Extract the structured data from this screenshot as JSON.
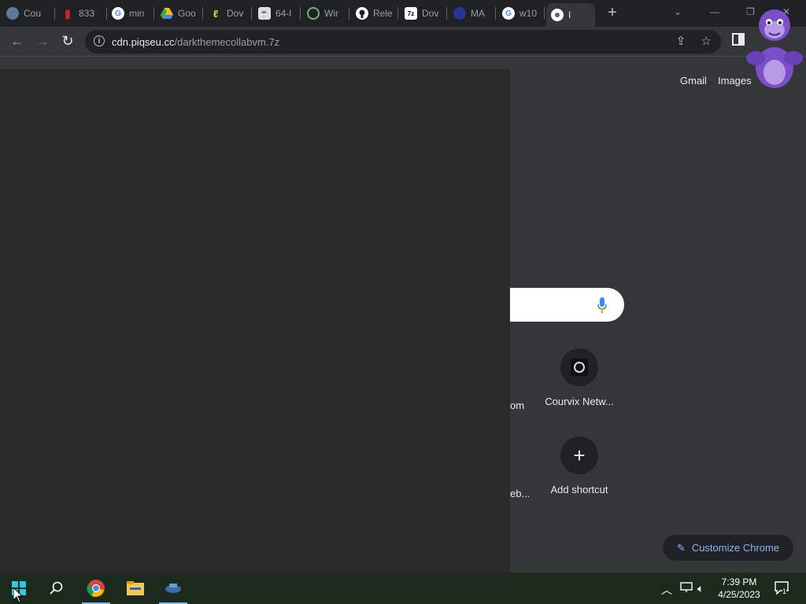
{
  "browser": {
    "tabs": [
      {
        "label": "Cou",
        "icon": "globe-icon",
        "color": "#8ab4f8"
      },
      {
        "label": "833",
        "icon": "red-mark-icon",
        "color": "#c62828"
      },
      {
        "label": "min",
        "icon": "google-icon",
        "color": "#ffffff"
      },
      {
        "label": "Goo",
        "icon": "drive-icon",
        "color": "#fbbc04"
      },
      {
        "label": "Dov",
        "icon": "leaf-icon",
        "color": "#cddc39"
      },
      {
        "label": "64-l",
        "icon": "java-icon",
        "color": "#ffffff"
      },
      {
        "label": "Wir",
        "icon": "chat-icon",
        "color": "#66bb6a"
      },
      {
        "label": "Rele",
        "icon": "github-icon",
        "color": "#ffffff"
      },
      {
        "label": "Dov",
        "icon": "7zip-icon",
        "color": "#ffffff"
      },
      {
        "label": "MA",
        "icon": "mas-icon",
        "color": "#3949ab"
      },
      {
        "label": "w10",
        "icon": "google-icon",
        "color": "#ffffff"
      },
      {
        "label": "I",
        "icon": "chrome-icon",
        "color": "#ffffff",
        "active": true
      }
    ],
    "new_tab_label": "+",
    "url_host": "cdn.piqseu.cc",
    "url_path": "/darkthemecollabvm.7z"
  },
  "ntp": {
    "gmail_label": "Gmail",
    "images_label": "Images",
    "shortcuts": [
      {
        "label": "Courvix Netw...",
        "icon": "courvix-icon"
      },
      {
        "label": "Add shortcut",
        "icon": "plus-icon"
      }
    ],
    "partial_labels": [
      "om",
      "eb..."
    ],
    "customize_label": "Customize Chrome"
  },
  "taskbar": {
    "time": "7:39 PM",
    "date": "4/25/2023",
    "notification_count": "1",
    "apps": [
      "start-icon",
      "search-icon",
      "chrome-icon",
      "file-explorer-icon",
      "vm-icon"
    ]
  },
  "colors": {
    "accent": "#8ab4f8",
    "dark_bg": "#35363a",
    "tab_bg": "#202124"
  }
}
